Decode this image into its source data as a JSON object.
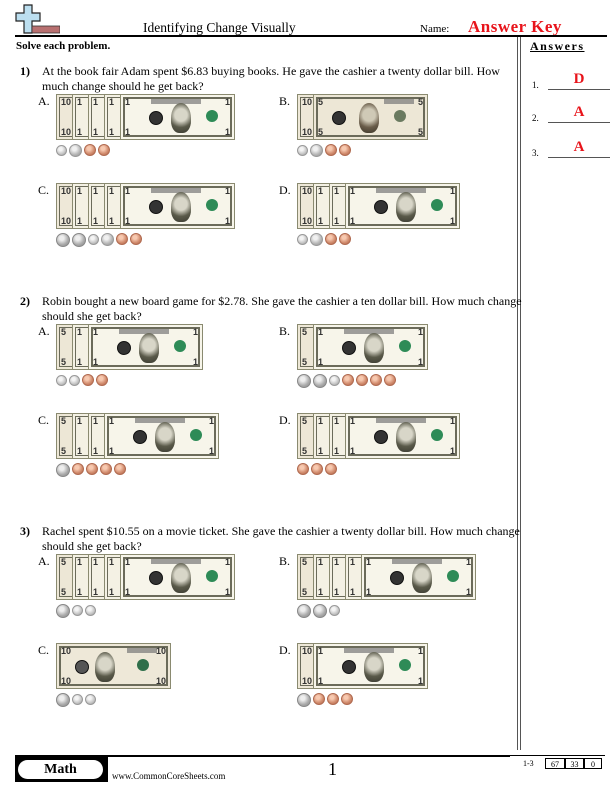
{
  "header": {
    "title": "Identifying Change Visually",
    "name_label": "Name:",
    "name_value": "Answer Key",
    "instructions": "Solve each problem."
  },
  "colors": {
    "answer_red": "#e8141b"
  },
  "answers_panel": {
    "title": "Answers",
    "items": [
      {
        "num": "1.",
        "value": "D"
      },
      {
        "num": "2.",
        "value": "A"
      },
      {
        "num": "3.",
        "value": "A"
      }
    ]
  },
  "questions": [
    {
      "num": "1)",
      "text": "At the book fair Adam spent $6.83 buying books. He gave the cashier a twenty dollar bill. How much change should he get back?",
      "choices": [
        {
          "letter": "A.",
          "bills": [
            "ten",
            "one",
            "one",
            "one",
            "one"
          ],
          "coins": [
            "dime",
            "nickel",
            "penny",
            "penny"
          ]
        },
        {
          "letter": "B.",
          "bills": [
            "ten",
            "five"
          ],
          "coins": [
            "dime",
            "nickel",
            "penny",
            "penny"
          ]
        },
        {
          "letter": "C.",
          "bills": [
            "ten",
            "one",
            "one",
            "one",
            "one"
          ],
          "coins": [
            "quarter",
            "quarter",
            "dime",
            "nickel",
            "penny",
            "penny"
          ]
        },
        {
          "letter": "D.",
          "bills": [
            "ten",
            "one",
            "one",
            "one"
          ],
          "coins": [
            "dime",
            "nickel",
            "penny",
            "penny"
          ]
        }
      ]
    },
    {
      "num": "2)",
      "text": "Robin bought a new board game for $2.78. She gave the cashier a ten dollar bill. How much change should she get back?",
      "choices": [
        {
          "letter": "A.",
          "bills": [
            "five",
            "one",
            "one"
          ],
          "coins": [
            "dime",
            "dime",
            "penny",
            "penny"
          ]
        },
        {
          "letter": "B.",
          "bills": [
            "five",
            "one"
          ],
          "coins": [
            "quarter",
            "quarter",
            "dime",
            "penny",
            "penny",
            "penny",
            "penny"
          ]
        },
        {
          "letter": "C.",
          "bills": [
            "five",
            "one",
            "one",
            "one"
          ],
          "coins": [
            "quarter",
            "penny",
            "penny",
            "penny",
            "penny"
          ]
        },
        {
          "letter": "D.",
          "bills": [
            "five",
            "one",
            "one",
            "one"
          ],
          "coins": [
            "penny",
            "penny",
            "penny"
          ]
        }
      ]
    },
    {
      "num": "3)",
      "text": "Rachel spent $10.55 on a movie ticket. She gave the cashier a twenty dollar bill. How much change should she get back?",
      "choices": [
        {
          "letter": "A.",
          "bills": [
            "five",
            "one",
            "one",
            "one",
            "one"
          ],
          "coins": [
            "quarter",
            "dime",
            "dime"
          ]
        },
        {
          "letter": "B.",
          "bills": [
            "five",
            "one",
            "one",
            "one",
            "one"
          ],
          "coins": [
            "quarter",
            "quarter",
            "dime"
          ]
        },
        {
          "letter": "C.",
          "bills": [
            "ten"
          ],
          "coins": [
            "quarter",
            "dime",
            "dime"
          ]
        },
        {
          "letter": "D.",
          "bills": [
            "ten",
            "one"
          ],
          "coins": [
            "quarter",
            "penny",
            "penny",
            "penny"
          ]
        }
      ]
    }
  ],
  "footer": {
    "subject": "Math",
    "site": "www.CommonCoreSheets.com",
    "page": "1",
    "score_range": "1-3",
    "scores": [
      "67",
      "33",
      "0"
    ]
  }
}
